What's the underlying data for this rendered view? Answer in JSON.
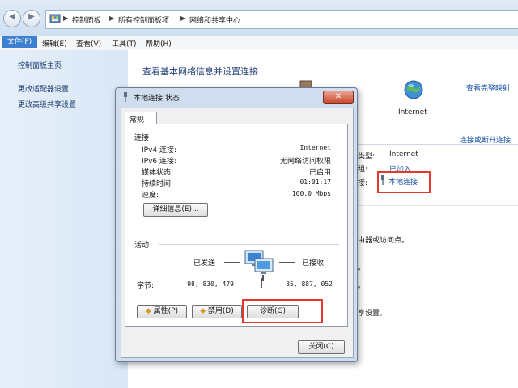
{
  "address_bar": {
    "breadcrumbs": [
      "控制面板",
      "所有控制面板项",
      "网络和共享中心"
    ]
  },
  "menu": {
    "items": [
      "文件(F)",
      "编辑(E)",
      "查看(V)",
      "工具(T)",
      "帮助(H)"
    ]
  },
  "sidebar": {
    "items": [
      "控制面板主页",
      "更改适配器设置",
      "更改高级共享设置"
    ]
  },
  "main": {
    "heading": "查看基本网络信息并设置连接",
    "view_full_map": "查看完整映射",
    "internet_label": "Internet",
    "connect_disconnect": "连接或断开连接",
    "access_type_label": "类型:",
    "access_type_value": "Internet",
    "homegroup_label": "组:",
    "homegroup_value": "已加入",
    "connections_label": "接:",
    "connection_link": "本地连接",
    "partial_text_1": "由器或访问点。",
    "partial_text_2": "。",
    "partial_text_3": "。",
    "partial_text_4": "享设置。"
  },
  "dialog": {
    "title": "本地连接 状态",
    "close_glyph": "✕",
    "tab": "常规",
    "connection_header": "连接",
    "fields": [
      {
        "label": "IPv4 连接:",
        "value": "Internet"
      },
      {
        "label": "IPv6 连接:",
        "value": "无网络访问权限"
      },
      {
        "label": "媒体状态:",
        "value": "已启用"
      },
      {
        "label": "持续时间:",
        "value": "01:01:17"
      },
      {
        "label": "速度:",
        "value": "100.0 Mbps"
      }
    ],
    "details_button": "详细信息(E)...",
    "activity_header": "活动",
    "sent_label": "已发送",
    "received_label": "已接收",
    "bytes_label": "字节:",
    "bytes_sent": "98, 830, 479",
    "bytes_received": "85, 887, 052",
    "properties_button": "属性(P)",
    "disable_button": "禁用(D)",
    "diagnose_button": "诊断(G)",
    "close_button": "关闭(C)"
  },
  "colors": {
    "highlight_red": "#e03a2e",
    "link_blue": "#1c55a8",
    "menu_selected": "#3d7fd1"
  }
}
